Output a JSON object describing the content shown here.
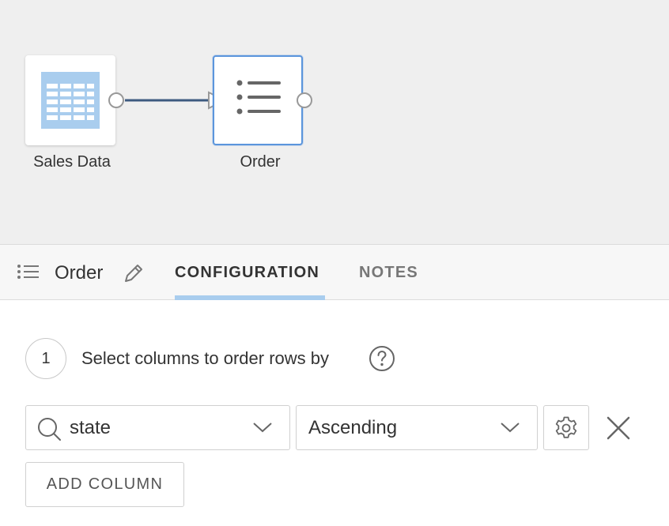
{
  "canvas": {
    "nodes": [
      {
        "label": "Sales Data",
        "icon": "table-icon"
      },
      {
        "label": "Order",
        "icon": "list-icon"
      }
    ],
    "colors": {
      "selected_border": "#5b95dc",
      "edge": "#3d5a80",
      "table_icon": "#a9cdee"
    }
  },
  "panel": {
    "title": "Order",
    "tabs": [
      {
        "label": "CONFIGURATION",
        "active": true
      },
      {
        "label": "NOTES",
        "active": false
      }
    ]
  },
  "config": {
    "step_number": "1",
    "step_text": "Select columns to order rows by",
    "order_rows": [
      {
        "column": "state",
        "direction": "Ascending"
      }
    ],
    "add_column_label": "ADD COLUMN"
  }
}
